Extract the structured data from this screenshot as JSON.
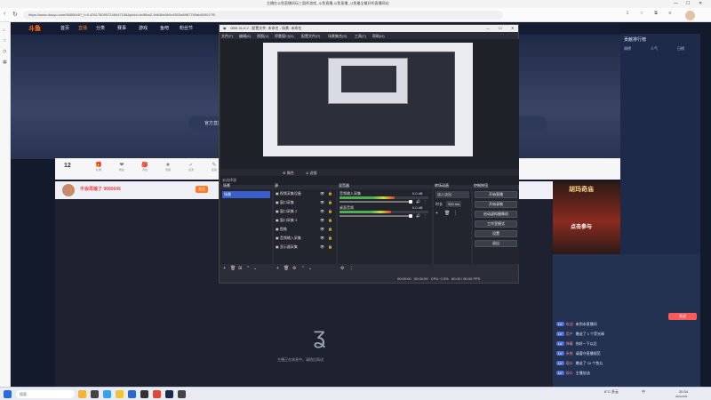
{
  "browser": {
    "tab_title": "主播在斗鱼直播间玩三国杀游戏_斗鱼直播,斗鱼直播_斗鱼最全最好的直播网站",
    "url": "https://www.douyu.com/9680646?_t=0.4261780957248447158&pluid=bc5fba2-9db3bb0b9c4503a8987769ab809017f0",
    "minimize": "—",
    "maximize": "☐",
    "close": "✕",
    "tool_icons": [
      {
        "icon": "download-icon",
        "label": ""
      },
      {
        "icon": "bookmark-icon",
        "label": ""
      },
      {
        "icon": "extension-icon",
        "label": ""
      },
      {
        "icon": "menu-icon",
        "label": ""
      }
    ]
  },
  "site": {
    "logo": "斗鱼",
    "nav": [
      "首页",
      "直播",
      "分类",
      "赛事",
      "游戏",
      "鱼吧",
      "粉丝节"
    ],
    "banner_pill": "官方直播间"
  },
  "giftbar": {
    "count": "12",
    "items": [
      "礼物",
      "粉丝",
      "背包",
      "贡献",
      "任务",
      "签到",
      "竞猜",
      "抽奖",
      "商城",
      "PK",
      "分享",
      "更多"
    ]
  },
  "streamer": {
    "name": "不会再输了 9680646",
    "follow": "关注"
  },
  "player": {
    "hint": "主播正在休息中，请稍后再试"
  },
  "right_panel": {
    "title": "贡献排行榜",
    "tabs": [
      "周榜",
      "人气",
      "日榜"
    ],
    "promo_title": "胡玛奇庙",
    "promo_cta": "点击参与"
  },
  "chat": {
    "messages": [
      {
        "badge": "LV",
        "user": "欢迎",
        "text": "来到本直播间"
      },
      {
        "badge": "LV",
        "user": "用户",
        "text": "赠送了 1 个荧光棒"
      },
      {
        "badge": "LV",
        "user": "弹幕",
        "text": "你好一下以后"
      },
      {
        "badge": "LV",
        "user": "系统",
        "text": "请遵守直播规范"
      },
      {
        "badge": "LV",
        "user": "观众",
        "text": "赠送了 10 个鱼丸"
      },
      {
        "badge": "LV",
        "user": "观众",
        "text": "主播加油"
      }
    ],
    "send": "发送"
  },
  "obs": {
    "title": "OBS 31.0.2 - 配置文件: 未命名 - 场景: 未命名",
    "menu": [
      "文件(F)",
      "编辑(E)",
      "视图(V)",
      "停靠窗口(D)",
      "配置文件(P)",
      "场景集合(S)",
      "工具(T)",
      "帮助(H)"
    ],
    "scene_preview_label": "未选择源",
    "ctrl_props": "⚙ 属性",
    "ctrl_filters": "⊘ 滤镜",
    "docks": {
      "scenes": "场景",
      "sources": "源",
      "mixer": "混音器",
      "transitions": "转场动画",
      "controls": "控制按钮"
    },
    "scene_list": [
      "场景"
    ],
    "source_list": [
      "视频采集设备",
      "窗口采集",
      "窗口采集 2",
      "窗口采集 3",
      "图像",
      "音频输入采集",
      "显示器采集"
    ],
    "mixer_tracks": [
      {
        "name": "音频输入采集",
        "db": "0.0 dB",
        "level": 0.62
      },
      {
        "name": "桌面音频",
        "db": "0.0 dB",
        "level": 0.58
      }
    ],
    "transition": {
      "type": "淡入淡出",
      "duration_label": "时长",
      "duration": "300 ms"
    },
    "control_buttons": [
      "开始直播",
      "开始录制",
      "启动虚拟摄像机",
      "工作室模式",
      "设置",
      "退出"
    ],
    "status": {
      "time1": "00:00:00",
      "time2": "00:00:00",
      "cpu": "CPU: 0.3%",
      "fps": "60.00 / 60.00 FPS"
    }
  },
  "taskbar": {
    "search_placeholder": "搜索",
    "weather": "8°C 多云",
    "lang": "中",
    "time": "20:34",
    "date": "2024/1/30"
  }
}
